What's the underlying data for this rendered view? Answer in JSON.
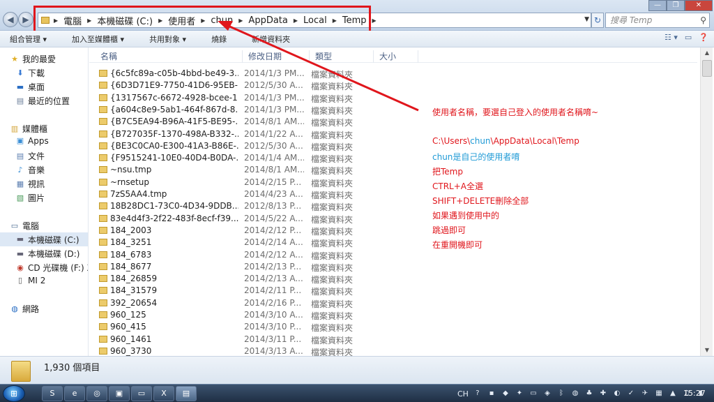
{
  "address_bar": {
    "crumbs": [
      "電腦",
      "本機磁碟 (C:)",
      "使用者",
      "chun",
      "AppData",
      "Local",
      "Temp"
    ]
  },
  "search": {
    "placeholder": "搜尋 Temp"
  },
  "toolbar": {
    "organize": "組合管理 ▾",
    "include_library": "加入至媒體櫃 ▾",
    "share": "共用對象 ▾",
    "burn": "燒錄",
    "new_folder": "新增資料夾"
  },
  "navpane": {
    "favorites": "我的最愛",
    "downloads": "下載",
    "desktop": "桌面",
    "recent": "最近的位置",
    "libraries": "媒體櫃",
    "apps": "Apps",
    "documents": "文件",
    "music": "音樂",
    "videos": "視訊",
    "pictures": "圖片",
    "computer": "電腦",
    "drive_c": "本機磁碟 (C:)",
    "drive_d": "本機磁碟 (D:)",
    "drive_f": "CD 光碟機 (F:) X",
    "mi2": "MI 2",
    "network": "網路"
  },
  "columns": {
    "name": "名稱",
    "modified": "修改日期",
    "type": "類型",
    "size": "大小"
  },
  "files": [
    {
      "name": "{6c5fc89a-c05b-4bbd-be49-3...",
      "date": "2014/1/3 PM...",
      "type": "檔案資料夾"
    },
    {
      "name": "{6D3D71E9-7750-41D6-95EB-...",
      "date": "2012/5/30 A...",
      "type": "檔案資料夾"
    },
    {
      "name": "{1317567c-6672-4928-bcee-1...",
      "date": "2014/1/3 PM...",
      "type": "檔案資料夾"
    },
    {
      "name": "{a604c8e9-5ab1-464f-867d-8...",
      "date": "2014/1/3 PM...",
      "type": "檔案資料夾"
    },
    {
      "name": "{B7C5EA94-B96A-41F5-BE95-...",
      "date": "2014/8/1 AM...",
      "type": "檔案資料夾"
    },
    {
      "name": "{B727035F-1370-498A-B332-...",
      "date": "2014/1/22 A...",
      "type": "檔案資料夾"
    },
    {
      "name": "{BE3C0CA0-E300-41A3-B86E-...",
      "date": "2012/5/30 A...",
      "type": "檔案資料夾"
    },
    {
      "name": "{F9515241-10E0-40D4-B0DA-...",
      "date": "2014/1/4 AM...",
      "type": "檔案資料夾"
    },
    {
      "name": "~nsu.tmp",
      "date": "2014/8/1 AM...",
      "type": "檔案資料夾"
    },
    {
      "name": "~rnsetup",
      "date": "2014/2/15 P...",
      "type": "檔案資料夾"
    },
    {
      "name": "7zS5AA4.tmp",
      "date": "2014/4/23 A...",
      "type": "檔案資料夾"
    },
    {
      "name": "18B28DC1-73C0-4D34-9DDB...",
      "date": "2012/8/13 P...",
      "type": "檔案資料夾"
    },
    {
      "name": "83e4d4f3-2f22-483f-8ecf-f39...",
      "date": "2014/5/22 A...",
      "type": "檔案資料夾"
    },
    {
      "name": "184_2003",
      "date": "2014/2/12 P...",
      "type": "檔案資料夾"
    },
    {
      "name": "184_3251",
      "date": "2014/2/14 A...",
      "type": "檔案資料夾"
    },
    {
      "name": "184_6783",
      "date": "2014/2/12 A...",
      "type": "檔案資料夾"
    },
    {
      "name": "184_8677",
      "date": "2014/2/13 P...",
      "type": "檔案資料夾"
    },
    {
      "name": "184_26859",
      "date": "2014/2/13 A...",
      "type": "檔案資料夾"
    },
    {
      "name": "184_31579",
      "date": "2014/2/11 P...",
      "type": "檔案資料夾"
    },
    {
      "name": "392_20654",
      "date": "2014/2/16 P...",
      "type": "檔案資料夾"
    },
    {
      "name": "960_125",
      "date": "2014/3/10 A...",
      "type": "檔案資料夾"
    },
    {
      "name": "960_415",
      "date": "2014/3/10 P...",
      "type": "檔案資料夾"
    },
    {
      "name": "960_1461",
      "date": "2014/3/11 P...",
      "type": "檔案資料夾"
    },
    {
      "name": "960_3730",
      "date": "2014/3/13 A...",
      "type": "檔案資料夾"
    }
  ],
  "annotation": {
    "line1": "使用者名稱，要選自己登入的使用者名稱唷~",
    "path_prefix": "C:\\Users\\",
    "path_user": "chun",
    "path_suffix": "\\AppData\\Local\\Temp",
    "line3_user": "chun",
    "line3_rest": "是自己的使用者唷",
    "line4": "把Temp",
    "line5": "CTRL+A全選",
    "line6": "SHIFT+DELETE刪除全部",
    "line7": "如果遇到使用中的",
    "line8": "跳過即可",
    "line9": "在重開機即可"
  },
  "status": {
    "count": "1,930 個項目"
  },
  "taskbar": {
    "lang": "CH",
    "time": "15:27"
  },
  "colors": {
    "annotation_red": "#e0161c",
    "annotation_blue": "#1f9ad6"
  }
}
